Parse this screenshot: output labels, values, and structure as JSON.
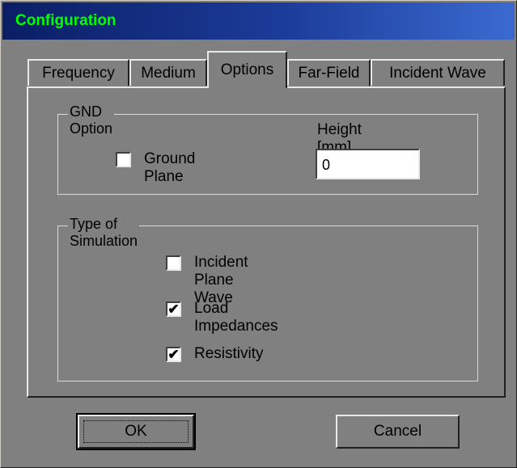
{
  "window": {
    "title": "Configuration"
  },
  "tabs": [
    {
      "label": "Frequency"
    },
    {
      "label": "Medium"
    },
    {
      "label": "Options",
      "active": true
    },
    {
      "label": "Far-Field"
    },
    {
      "label": "Incident Wave"
    }
  ],
  "gnd_group": {
    "label": "GND Option",
    "ground_plane": {
      "label": "Ground Plane",
      "checked": false
    },
    "height": {
      "label": "Height [mm]",
      "value": "0"
    }
  },
  "sim_group": {
    "label": "Type of Simulation",
    "options": [
      {
        "label": "Incident Plane Wave",
        "checked": false,
        "mark": ""
      },
      {
        "label": "Load Impedances",
        "checked": true,
        "mark": "✔"
      },
      {
        "label": "Resistivity",
        "checked": true,
        "mark": "✔"
      }
    ]
  },
  "buttons": {
    "ok": "OK",
    "cancel": "Cancel"
  }
}
